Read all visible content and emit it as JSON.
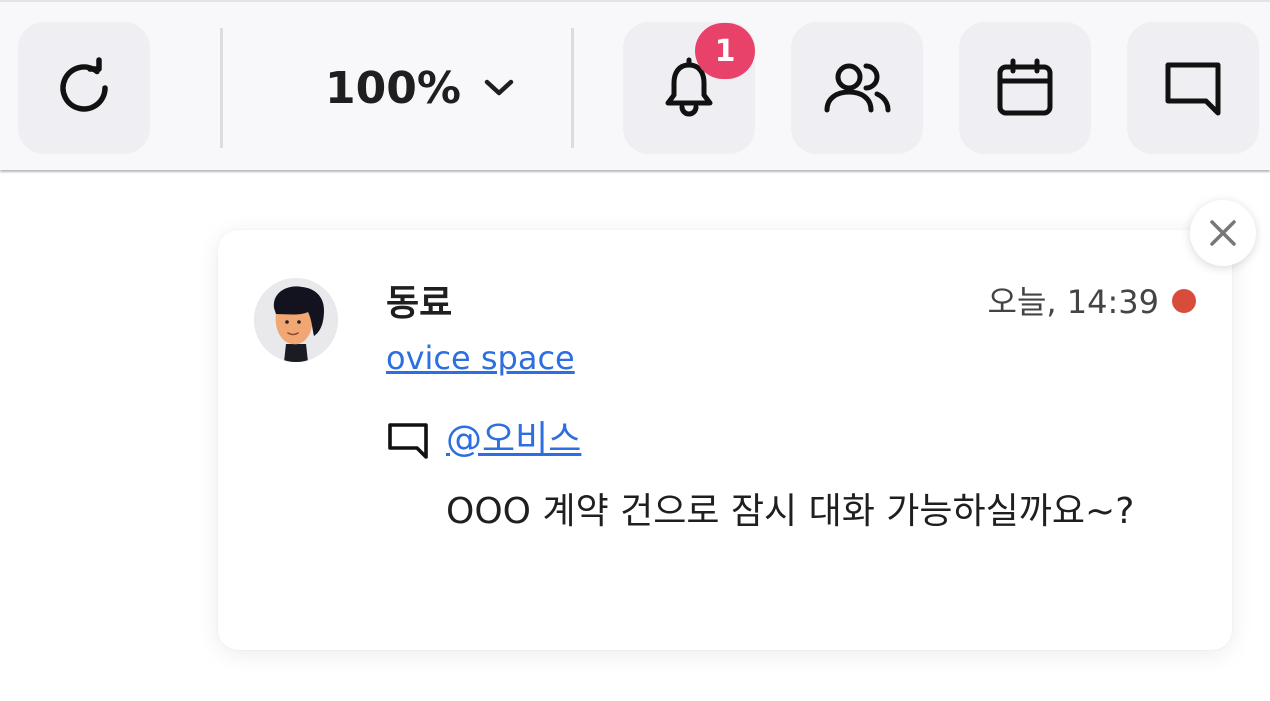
{
  "toolbar": {
    "refresh_icon": "refresh-icon",
    "zoom_level": "100%",
    "notifications_badge": "1",
    "notifications_icon": "bell-icon",
    "members_icon": "users-icon",
    "calendar_icon": "calendar-icon",
    "chat_icon": "chat-icon"
  },
  "notification": {
    "sender": "동료",
    "space": "ovice space",
    "time": "오늘, 14:39",
    "mention": "@오비스",
    "message": "OOO 계약 건으로 잠시 대화 가능하실까요~?",
    "unread_color": "#d94c3c"
  },
  "colors": {
    "accent_link": "#2d6fe0",
    "badge": "#e8426a",
    "toolbar_bg": "#f8f8fa",
    "button_bg": "#efeef2"
  }
}
